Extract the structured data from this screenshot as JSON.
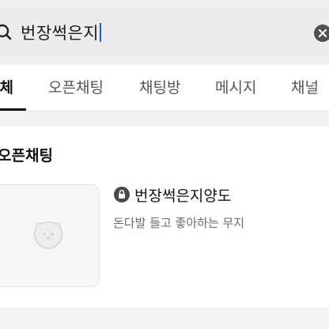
{
  "search": {
    "query": "번장썩은지"
  },
  "tabs": [
    {
      "label": "전체",
      "active": true
    },
    {
      "label": "오픈채팅",
      "active": false
    },
    {
      "label": "채팅방",
      "active": false
    },
    {
      "label": "메시지",
      "active": false
    },
    {
      "label": "채널",
      "active": false
    }
  ],
  "section": {
    "title": "오픈채팅"
  },
  "result": {
    "title": "번장썩은지양도",
    "description": "돈다발 들고 좋아하는 무지",
    "locked": true
  },
  "colors": {
    "caret": "#1e63d6",
    "active_tab": "#111111"
  }
}
